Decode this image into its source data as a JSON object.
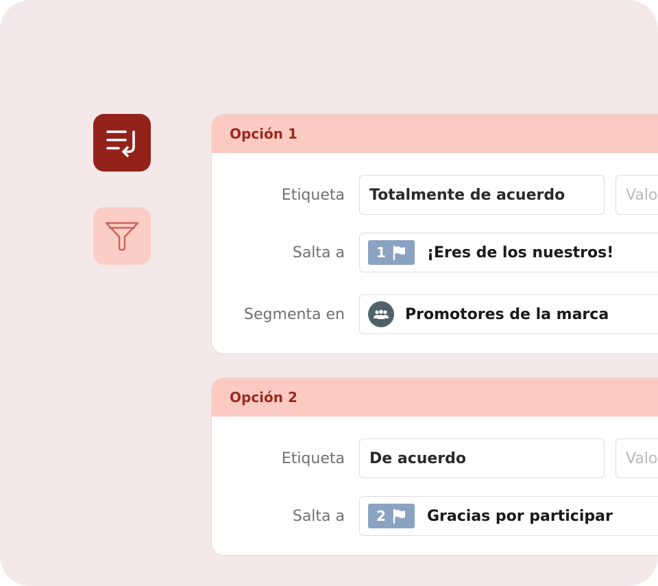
{
  "sidebar": {
    "tools": [
      {
        "name": "logic-jump",
        "icon": "list-return-icon",
        "active": true
      },
      {
        "name": "filter",
        "icon": "funnel-icon",
        "active": false
      }
    ]
  },
  "options": [
    {
      "title": "Opción 1",
      "label_caption": "Etiqueta",
      "label_value": "Totalmente de acuerdo",
      "value_placeholder": "Valor",
      "jump_caption": "Salta a",
      "jump_number": "1",
      "jump_target": "¡Eres de los nuestros!",
      "segment_caption": "Segmenta en",
      "segment_value": "Promotores de la marca"
    },
    {
      "title": "Opción 2",
      "label_caption": "Etiqueta",
      "label_value": "De acuerdo",
      "value_placeholder": "Valor",
      "jump_caption": "Salta a",
      "jump_number": "2",
      "jump_target": "Gracias por participar"
    }
  ],
  "colors": {
    "background": "#f5e8e8",
    "accent_dark": "#92221a",
    "accent_light": "#fbcbc3",
    "badge": "#8aa3c2",
    "segment_icon": "#4f6269"
  }
}
